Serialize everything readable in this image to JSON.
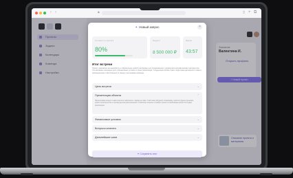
{
  "browser": {
    "url": ""
  },
  "app": {
    "sidebar": {
      "items": [
        "Проекты",
        "Задачи",
        "Календарь",
        "Команда",
        "Настройки"
      ]
    },
    "right_panel": {
      "label": "Заказчик",
      "name": "Валентина И.",
      "link": "Открыть профиль",
      "button": "+ Новый проект",
      "thumb_text": "Описание проекта\nи материалы"
    }
  },
  "modal": {
    "title": "Новый запрос",
    "close_icon": "close-icon",
    "stats": [
      {
        "label": "Готовность проекта",
        "value": "80%",
        "progress": 0.8
      },
      {
        "label": "Бюджет",
        "value": "8 500 000 ₽"
      },
      {
        "label": "Время",
        "value": "43:57"
      }
    ],
    "summary_title": "Итог встречи",
    "summary_text": "Проект направлен на разработку и оформление новой платформы для продвижения и управления направлениями партнёрства. Согласованы ключевые цели, финансовые условия и сроки реализации. Следующим шагом станет подготовка детального плана и распределение ответственности между участниками команды.",
    "accordion": [
      {
        "title": "Цель встречи",
        "expanded": false,
        "body": ""
      },
      {
        "title": "Презентация объекта",
        "expanded": true,
        "body": "Презентован концепт нового жилого комплекса с видом на парк. Участники обсудили планировку, архитектурные решения, сроки строительства и преимущества расположения. Отмечены сильные стороны проекта и возможные риски на стадии реализации."
      },
      {
        "title": "Финансовые условия",
        "expanded": false,
        "body": ""
      },
      {
        "title": "Вопросы клиента",
        "expanded": false,
        "body": ""
      },
      {
        "title": "Дальнейшие шаги",
        "expanded": false,
        "body": ""
      }
    ],
    "cta": "Сохранить итог"
  },
  "colors": {
    "accent": "#7c6cf0",
    "success": "#3bb86a"
  }
}
